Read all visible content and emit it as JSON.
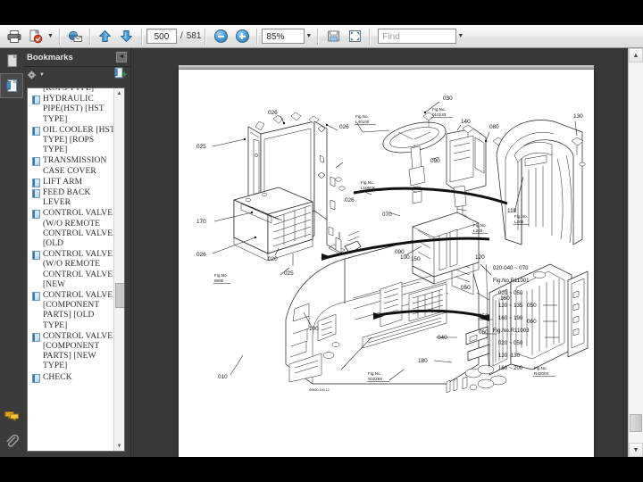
{
  "window": {
    "viewer_name": "pdf-reader"
  },
  "toolbar": {
    "print_icon": "printer-icon",
    "save_icon": "save-copy-icon",
    "email_icon": "email-icon",
    "prev_page_icon": "arrow-up-icon",
    "next_page_icon": "arrow-down-icon",
    "page_number": "500",
    "page_separator": "/",
    "page_total": "581",
    "zoom_out_icon": "zoom-out-icon",
    "zoom_in_icon": "zoom-in-icon",
    "zoom_level": "85%",
    "zoom_dropdown_icon": "chevron-down-icon",
    "fit_width_icon": "fit-width-icon",
    "fit_page_icon": "fit-page-icon",
    "find_placeholder": "Find",
    "find_value": "",
    "find_dropdown_icon": "chevron-down-icon"
  },
  "rail": {
    "pages_icon": "page-thumbnails-icon",
    "bookmarks_icon": "bookmarks-icon",
    "comments_icon": "comments-icon",
    "attachments_icon": "attachments-icon"
  },
  "bookmarks_panel": {
    "title": "Bookmarks",
    "collapse_icon": "collapse-panel-icon",
    "options_icon": "options-gear-icon",
    "options_caret_icon": "chevron-down-icon",
    "new_bookmark_icon": "new-bookmark-icon",
    "scroll_up_icon": "chevron-up-icon",
    "scroll_down_icon": "chevron-down-icon",
    "items": [
      {
        "label": "[ROPS TYPE]",
        "partial_top": true
      },
      {
        "label": "HYDRAULIC PIPE(HST) [HST TYPE]"
      },
      {
        "label": "OIL COOLER [HST TYPE] [ROPS TYPE]"
      },
      {
        "label": "TRANSMISSION CASE COVER"
      },
      {
        "label": "LIFT ARM"
      },
      {
        "label": "FEED BACK LEVER"
      },
      {
        "label": "CONTROL VALVE (W/O REMOTE CONTROL VALVE) [OLD"
      },
      {
        "label": "CONTROL VALVE (W/O REMOTE CONTROL VALVE) [NEW"
      },
      {
        "label": "CONTROL VALVE [COMPONENT PARTS] [OLD TYPE]"
      },
      {
        "label": "CONTROL VALVE [COMPONENT PARTS] [NEW TYPE]"
      },
      {
        "label": "CHECK",
        "partial_bottom": true
      }
    ]
  },
  "document": {
    "diagram_title": "tractor-parts-exploded-diagram",
    "callouts": [
      "025",
      "026",
      "026",
      "026",
      "026",
      "170",
      "020",
      "025",
      "030",
      "070",
      "090",
      "100",
      "140",
      "080",
      "110",
      "130",
      "150",
      "120",
      "010",
      "040",
      "050",
      "060",
      "180",
      "160"
    ],
    "fig_refs": [
      "Fig.No.\nL40100",
      "Fig.No.\nL1050X",
      "Fig.No.\n8595",
      "Fig.No.\n010133",
      "Fig.No.\nL203",
      "Fig.No.\nL203",
      "Fig.No.\nS0228X",
      "Fig.No.\nR4200X"
    ],
    "ref_table": [
      "020·040 ~ 070",
      "Fig.No.R11001",
      "020 ~ 050",
      "120 ~ 135",
      "160 ~ 190",
      "Fig.No.R11003",
      "020 ~ 050",
      "120 ·130",
      "160 ~ 200"
    ],
    "small_note": "S0600-190-12",
    "scroll_up_icon": "chevron-up-icon",
    "scroll_down_icon": "chevron-down-icon"
  },
  "colors": {
    "toolbar_bg": "#eeeeee",
    "panel_bg": "#3b3b3b",
    "viewer_bg": "#373737",
    "page_bg": "#ffffff",
    "accent_blue": "#4a9ad6",
    "letterbox": "#000000"
  }
}
